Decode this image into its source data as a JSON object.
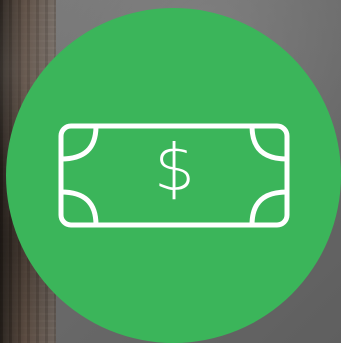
{
  "colors": {
    "badge_green": "#3bb55a",
    "icon_stroke": "#ffffff"
  },
  "badge": {
    "icon_name": "banknote-icon",
    "currency_symbol": "$"
  }
}
